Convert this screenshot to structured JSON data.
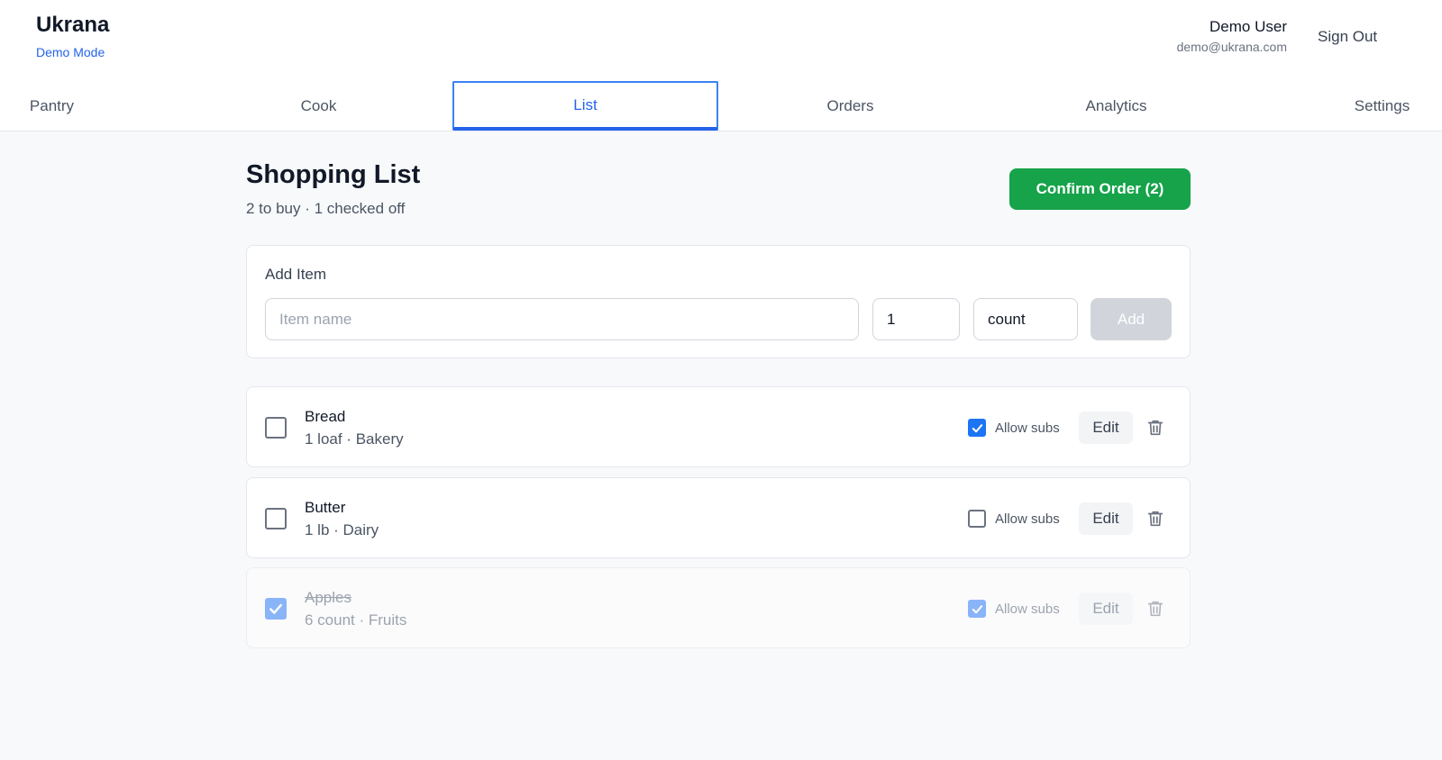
{
  "app": {
    "title": "Ukrana",
    "mode": "Demo Mode"
  },
  "user": {
    "name": "Demo User",
    "email": "demo@ukrana.com",
    "signout_label": "Sign Out"
  },
  "nav": {
    "tabs": [
      {
        "label": "Pantry",
        "active": false
      },
      {
        "label": "Cook",
        "active": false
      },
      {
        "label": "List",
        "active": true
      },
      {
        "label": "Orders",
        "active": false
      },
      {
        "label": "Analytics",
        "active": false
      },
      {
        "label": "Settings",
        "active": false
      }
    ]
  },
  "page": {
    "title": "Shopping List",
    "subtitle": "2 to buy · 1 checked off",
    "confirm_label": "Confirm Order (2)"
  },
  "add_item": {
    "label": "Add Item",
    "name_placeholder": "Item name",
    "quantity_value": "1",
    "unit_value": "count",
    "add_label": "Add"
  },
  "items": [
    {
      "name": "Bread",
      "meta": "1 loaf · Bakery",
      "checked": false,
      "allow_subs": true,
      "subs_label": "Allow subs",
      "edit_label": "Edit"
    },
    {
      "name": "Butter",
      "meta": "1 lb · Dairy",
      "checked": false,
      "allow_subs": false,
      "subs_label": "Allow subs",
      "edit_label": "Edit"
    },
    {
      "name": "Apples",
      "meta": "6 count · Fruits",
      "checked": true,
      "allow_subs": true,
      "subs_label": "Allow subs",
      "edit_label": "Edit"
    }
  ],
  "colors": {
    "accent": "#2563eb",
    "confirm": "#16a34a",
    "checkbox": "#1d74f5"
  }
}
